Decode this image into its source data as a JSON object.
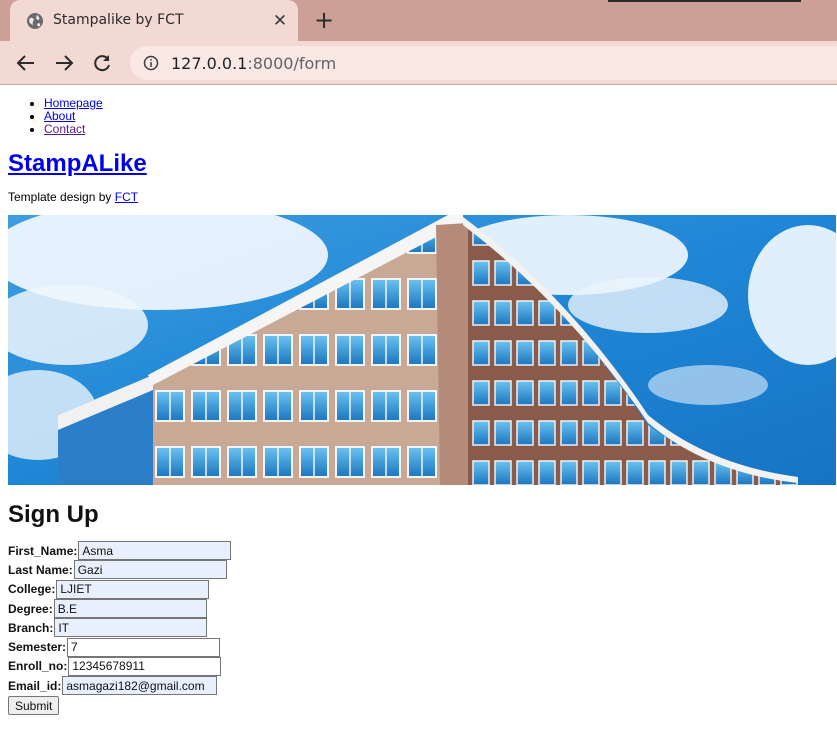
{
  "browser": {
    "tab_title": "Stampalike by FCT",
    "close_glyph": "✕",
    "new_tab_glyph": "+",
    "url_host": "127.0.0.1",
    "url_rest": ":8000/form",
    "tab_color": "#f3d9d4",
    "frame_color": "#cda097"
  },
  "nav": {
    "items": [
      {
        "label": "Homepage",
        "visited": false
      },
      {
        "label": "About",
        "visited": false
      },
      {
        "label": "Contact",
        "visited": true
      }
    ]
  },
  "site": {
    "title": "StampALike",
    "credit_prefix": "Template design by ",
    "credit_link": "FCT"
  },
  "hero": {
    "icon": "building-photo"
  },
  "form": {
    "title": "Sign Up",
    "fields": [
      {
        "label": "First_Name:",
        "value": "Asma"
      },
      {
        "label": "Last Name:",
        "value": "Gazi"
      },
      {
        "label": "College:",
        "value": "LJIET"
      },
      {
        "label": "Degree:",
        "value": "B.E"
      },
      {
        "label": "Branch:",
        "value": "IT"
      },
      {
        "label": "Semester:",
        "value": "7"
      },
      {
        "label": "Enroll_no:",
        "value": "12345678911"
      },
      {
        "label": "Email_id:",
        "value": "asmagazi182@gmail.com"
      }
    ],
    "submit_label": "Submit",
    "autofill_color": "#e8f0fe"
  }
}
